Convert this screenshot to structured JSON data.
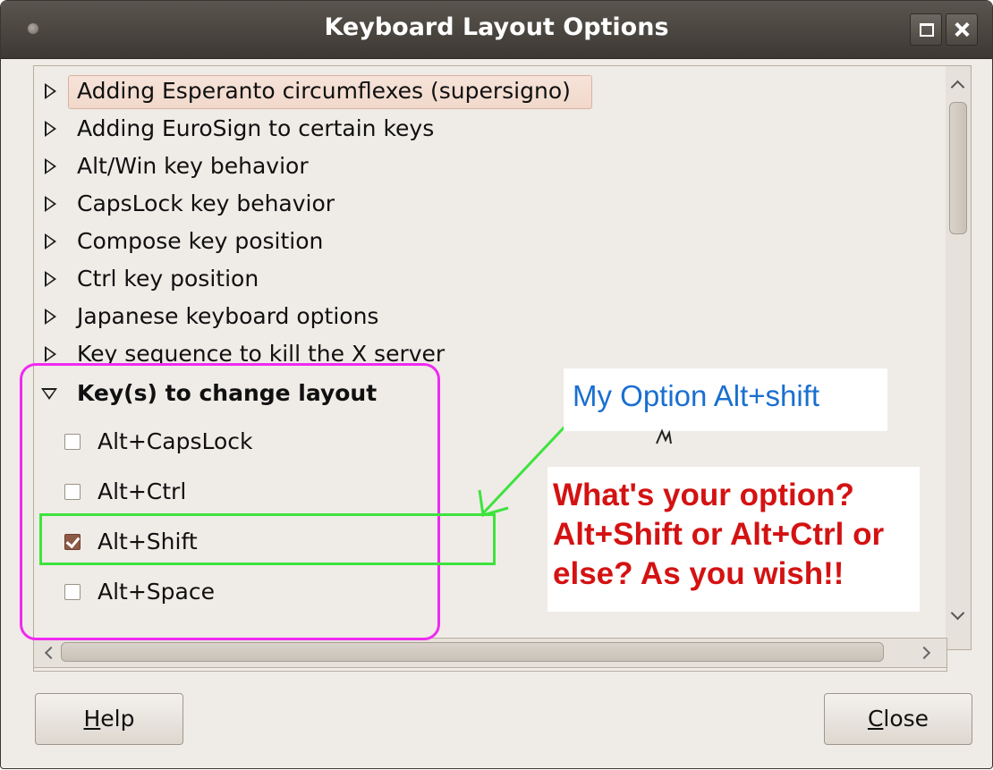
{
  "window": {
    "title": "Keyboard Layout Options"
  },
  "tree": {
    "collapsed_items": [
      "Adding Esperanto circumflexes (supersigno)",
      "Adding EuroSign to certain keys",
      "Alt/Win key behavior",
      "CapsLock key behavior",
      "Compose key position",
      "Ctrl key position",
      "Japanese keyboard options",
      "Key sequence to kill the X server"
    ],
    "expanded_group": {
      "label": "Key(s) to change layout",
      "options": [
        {
          "label": "Alt+CapsLock",
          "checked": false
        },
        {
          "label": "Alt+Ctrl",
          "checked": false
        },
        {
          "label": "Alt+Shift",
          "checked": true
        },
        {
          "label": "Alt+Space",
          "checked": false
        }
      ]
    }
  },
  "buttons": {
    "help_mnemonic": "H",
    "help_rest": "elp",
    "close_mnemonic": "C",
    "close_rest": "lose"
  },
  "annotations": {
    "note_blue": "My Option Alt+shift",
    "note_red_lines": [
      "What's your option?",
      "Alt+Shift or Alt+Ctrl or",
      "else? As you wish!!"
    ]
  },
  "colors": {
    "highlight_box": "#f02af0",
    "green_box": "#3de33d",
    "blue_note": "#1a6fd0",
    "red_note": "#d41212",
    "checkbox_checked": "#8d5a46"
  }
}
